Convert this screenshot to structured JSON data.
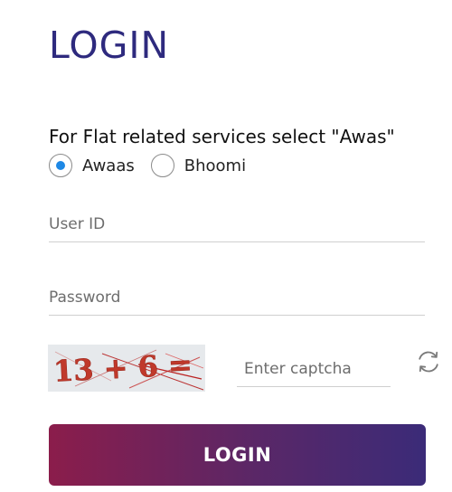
{
  "header": {
    "title": "LOGIN"
  },
  "service_selector": {
    "instruction": "For Flat related services select \"Awas\"",
    "options": [
      {
        "label": "Awaas",
        "selected": true
      },
      {
        "label": "Bhoomi",
        "selected": false
      }
    ]
  },
  "form": {
    "user_id": {
      "placeholder": "User ID",
      "value": ""
    },
    "password": {
      "placeholder": "Password",
      "value": ""
    },
    "captcha": {
      "image_text": "13 + 6 =",
      "input_placeholder": "Enter captcha",
      "input_value": ""
    },
    "submit_label": "LOGIN"
  },
  "icons": {
    "refresh": "refresh-icon",
    "radio_checked": "radio-checked-icon",
    "radio_unchecked": "radio-unchecked-icon"
  },
  "colors": {
    "title": "#2e2a7e",
    "radio_dot": "#1e88e5",
    "button_gradient_start": "#8b1d4b",
    "button_gradient_end": "#3b2b78",
    "captcha_text": "#c0392b"
  }
}
